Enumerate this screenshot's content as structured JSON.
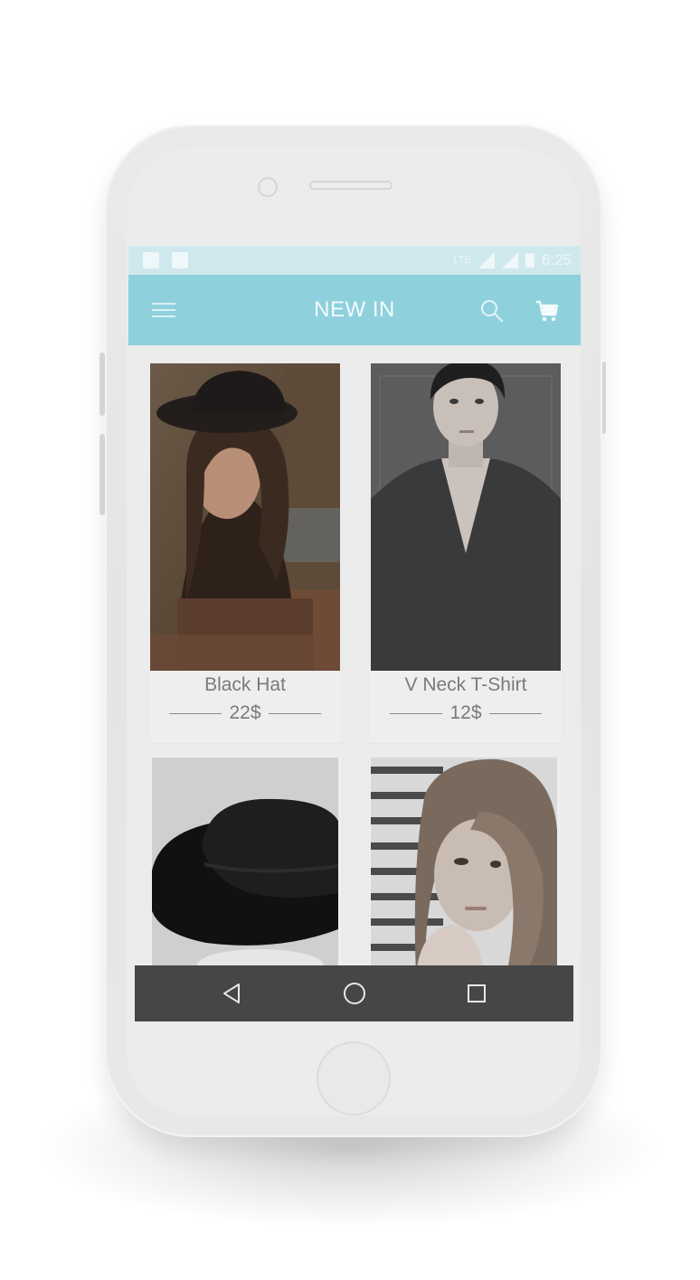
{
  "status_bar": {
    "network": "LTE",
    "time": "6:25"
  },
  "app_bar": {
    "title": "NEW IN",
    "menu_icon": "hamburger-menu-icon",
    "search_icon": "search-icon",
    "cart_icon": "cart-icon"
  },
  "products": [
    {
      "name": "Black Hat",
      "price": "22$",
      "image": "woman-in-black-hat-photo"
    },
    {
      "name": "V Neck T-Shirt",
      "price": "12$",
      "image": "man-in-v-neck-shirt-photo"
    },
    {
      "name": "",
      "price": "",
      "image": "black-wide-brim-hat-photo"
    },
    {
      "name": "",
      "price": "",
      "image": "woman-portrait-photo"
    }
  ],
  "nav_bar": {
    "back_icon": "back-triangle-icon",
    "home_icon": "home-circle-icon",
    "recents_icon": "recents-square-icon"
  },
  "colors": {
    "app_bar": "#8fd0dd",
    "status_bar": "#cfe8ee",
    "nav_bar": "#464646",
    "text": "#7a7a7a"
  }
}
